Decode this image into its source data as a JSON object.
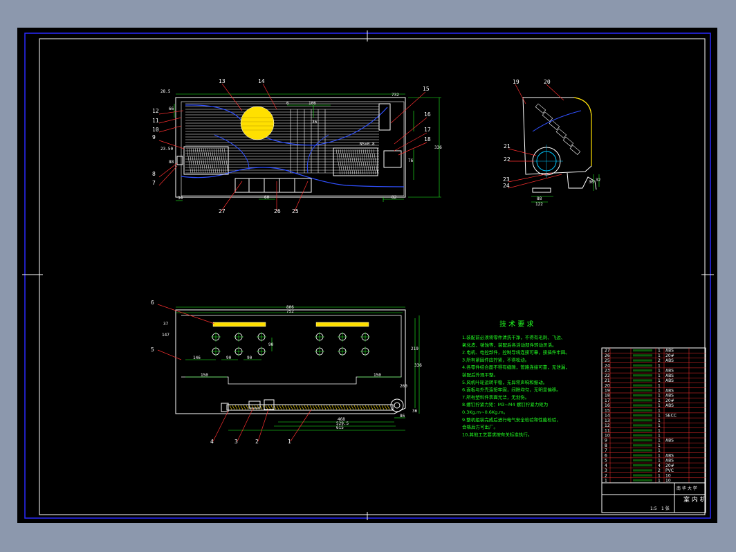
{
  "colors": {
    "background": "#8c98ad",
    "sheet": "#000000",
    "border": "#2a2aff",
    "outline": "#ffffff",
    "leader": "#ff3030",
    "green": "#22ff22",
    "fill_yellow": "#ffe000",
    "blue_curve": "#3050ff",
    "cyan": "#00c8ff"
  },
  "views": {
    "front": {
      "balloons": [
        "13",
        "14",
        "15",
        "16",
        "17",
        "18",
        "12",
        "11",
        "10",
        "9",
        "8",
        "7",
        "27",
        "26",
        "25"
      ],
      "dims": [
        "28.5",
        "66",
        "732",
        "6",
        "106",
        "36",
        "N5×0.8",
        "23.50",
        "88",
        "336",
        "76",
        "34",
        "60",
        "82"
      ]
    },
    "side": {
      "balloons": [
        "19",
        "20",
        "21",
        "22",
        "23",
        "24"
      ],
      "dims": [
        "122",
        "88",
        "36",
        "32"
      ]
    },
    "bottom": {
      "balloons": [
        "6",
        "5",
        "4",
        "3",
        "2",
        "1"
      ],
      "dims": [
        "806",
        "752",
        "37",
        "147",
        "90",
        "146",
        "90",
        "90",
        "150",
        "150",
        "219",
        "336",
        "260",
        "36",
        "468",
        "529.5",
        "615",
        "86"
      ]
    }
  },
  "requirements": {
    "title": "技 术 要 求",
    "lines": [
      "1.装配前必须将零件清洗干净，不得有毛刺、飞边、",
      "  氧化皮、锈蚀等，装配后各活动部件转动灵活。",
      "2.电机、电控部件，控制导线连接可靠，接插件牢固。",
      "3.所有紧固件应拧紧，不得松动。",
      "4.各零件结合面不得有缝隙，管路连接可靠，无泄漏，",
      "  装配后外观平整。",
      "5.风机叶轮运转平稳，无异常声响和振动。",
      "6.面板与外壳连接牢固，间隙均匀，无明显偏移。",
      "7.所有塑料件表面光洁，无划伤。",
      "8.螺钉拧紧力矩：M3~M4 螺钉拧紧力矩为",
      "0.3Kg.m~0.6Kg.m。",
      "9.整机组装完成后进行电气安全检验和性能检验，",
      "  合格后方可出厂。",
      "10.其他工艺要求按有关标准执行。"
    ]
  },
  "bom": {
    "rows": [
      {
        "no": "27",
        "qty": "1",
        "mat": "ABS"
      },
      {
        "no": "26",
        "qty": "1",
        "mat": "20#"
      },
      {
        "no": "25",
        "qty": "2",
        "mat": "ABS"
      },
      {
        "no": "24",
        "qty": "1",
        "mat": ""
      },
      {
        "no": "23",
        "qty": "1",
        "mat": "ABS"
      },
      {
        "no": "22",
        "qty": "1",
        "mat": "ABS"
      },
      {
        "no": "21",
        "qty": "1",
        "mat": "ABS"
      },
      {
        "no": "20",
        "qty": "1",
        "mat": ""
      },
      {
        "no": "19",
        "qty": "1",
        "mat": "ABS"
      },
      {
        "no": "18",
        "qty": "1",
        "mat": "ABS"
      },
      {
        "no": "17",
        "qty": "1",
        "mat": "20#"
      },
      {
        "no": "16",
        "qty": "1",
        "mat": "ABS"
      },
      {
        "no": "15",
        "qty": "1",
        "mat": ""
      },
      {
        "no": "14",
        "qty": "1",
        "mat": "SECC"
      },
      {
        "no": "13",
        "qty": "1",
        "mat": ""
      },
      {
        "no": "12",
        "qty": "1",
        "mat": ""
      },
      {
        "no": "11",
        "qty": "1",
        "mat": ""
      },
      {
        "no": "10",
        "qty": "1",
        "mat": ""
      },
      {
        "no": "9",
        "qty": "1",
        "mat": "ABS"
      },
      {
        "no": "8",
        "qty": "1",
        "mat": ""
      },
      {
        "no": "7",
        "qty": "1",
        "mat": ""
      },
      {
        "no": "6",
        "qty": "1",
        "mat": "ABS"
      },
      {
        "no": "5",
        "qty": "1",
        "mat": "ABS"
      },
      {
        "no": "4",
        "qty": "4",
        "mat": "20#"
      },
      {
        "no": "3",
        "qty": "2",
        "mat": "PVC"
      },
      {
        "no": "2",
        "qty": "1",
        "mat": "10"
      },
      {
        "no": "1",
        "qty": "1",
        "mat": "10"
      }
    ]
  },
  "title_block": {
    "org": "南 华 大 学",
    "name": "室 内 机",
    "scale": "1:5",
    "sheet": "1 张"
  }
}
